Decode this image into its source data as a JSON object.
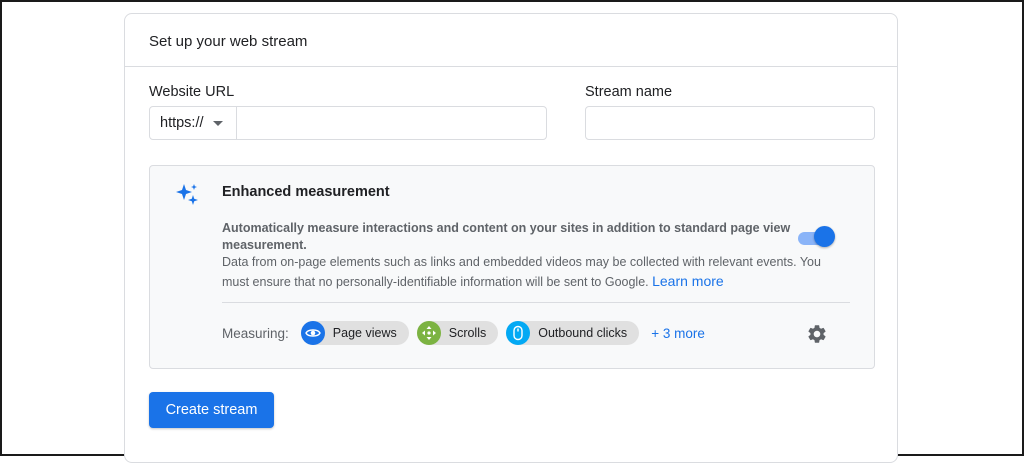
{
  "card": {
    "title": "Set up your web stream"
  },
  "website_url": {
    "label": "Website URL",
    "protocol": "https://",
    "value": ""
  },
  "stream_name": {
    "label": "Stream name",
    "value": ""
  },
  "enhanced_measurement": {
    "title": "Enhanced measurement",
    "description": "Automatically measure interactions and content on your sites in addition to standard page view measurement.",
    "note": "Data from on-page elements such as links and embedded videos may be collected with relevant events. You must ensure that no personally-identifiable information will be sent to Google.",
    "learn_more": "Learn more",
    "toggle_on": true,
    "measuring_label": "Measuring:",
    "chips": [
      {
        "label": "Page views",
        "icon": "eye-icon",
        "color": "#1a73e8"
      },
      {
        "label": "Scrolls",
        "icon": "scroll-arrows-icon",
        "color": "#7cb342"
      },
      {
        "label": "Outbound clicks",
        "icon": "mouse-icon",
        "color": "#03a9f4"
      }
    ],
    "more": "+ 3 more"
  },
  "actions": {
    "create": "Create stream"
  },
  "colors": {
    "accent": "#1a73e8",
    "panel": "#f8f9fa",
    "border": "#dadce0"
  }
}
